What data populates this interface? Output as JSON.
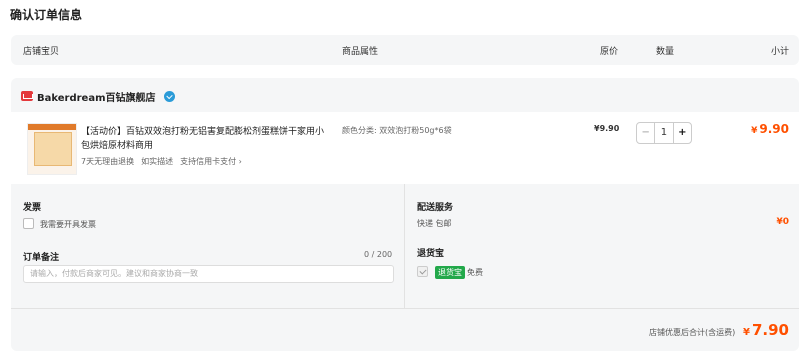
{
  "page": {
    "title": "确认订单信息"
  },
  "header": {
    "shop_item": "店铺宝贝",
    "attributes": "商品属性",
    "unit_price": "原价",
    "quantity": "数量",
    "subtotal": "小计"
  },
  "shop": {
    "name": "Bakerdream百钻旗舰店",
    "icons": {
      "store": "store-icon",
      "badge": "verified-badge-icon"
    }
  },
  "item": {
    "title": "【活动价】百钻双效泡打粉无铝害复配膨松剂蛋糕饼干家用小包烘焙原材料商用",
    "tags": [
      "7天无理由退换",
      "如实描述",
      "支持信用卡支付 ›"
    ],
    "attribute": "颜色分类: 双效泡打粉50g*6袋",
    "unit_price": "¥9.90",
    "quantity": "1",
    "minus": "−",
    "plus": "+",
    "subtotal_symbol": "¥",
    "subtotal": "9.90"
  },
  "invoice": {
    "title": "发票",
    "checkbox_label": "我需要开具发票"
  },
  "remark": {
    "title": "订单备注",
    "counter": "0 / 200",
    "placeholder": "请输入，付款后商家可见。建议和商家协商一致"
  },
  "delivery": {
    "title": "配送服务",
    "method": "快递 包邮",
    "fee": "¥0"
  },
  "return_insurance": {
    "title": "退货宝",
    "badge": "退货宝",
    "label": "免费"
  },
  "summary": {
    "label": "店铺优惠后合计(含运费)",
    "symbol": "¥",
    "total": "7.90"
  },
  "colors": {
    "accent": "#ff5000",
    "badge_green": "#22a84a",
    "panel_bg": "#f5f6f7"
  }
}
